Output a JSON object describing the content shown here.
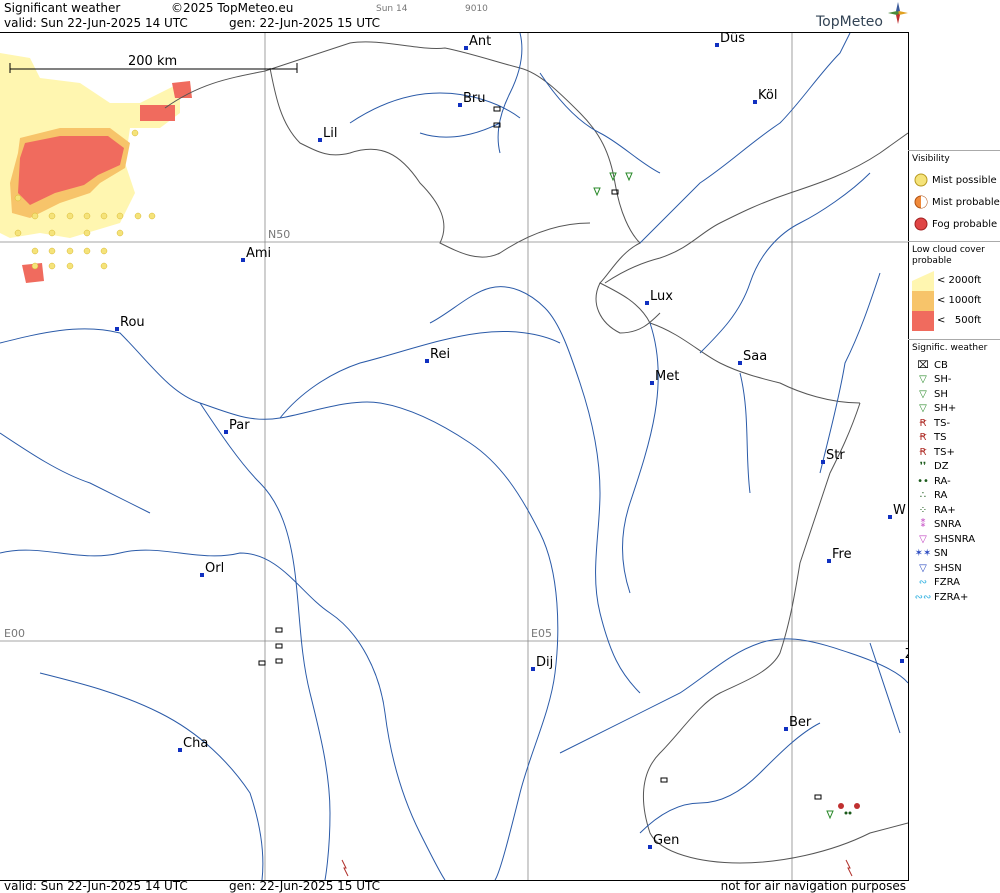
{
  "header": {
    "title": "Significant weather",
    "copyright": "©2025 TopMeteo.eu",
    "run_small": "Sun 14",
    "code_small": "9010",
    "valid": "valid:  Sun  22-Jun-2025  14 UTC",
    "gen": "gen: 22-Jun-2025 15 UTC",
    "logo": "TopMeteo"
  },
  "footer": {
    "valid": "valid:  Sun  22-Jun-2025  14 UTC",
    "gen": "gen: 22-Jun-2025 15 UTC",
    "disclaimer": "not for air navigation purposes"
  },
  "map": {
    "scale_label": "200 km",
    "grid_labels": {
      "lat": "N50",
      "lon_west": "E00",
      "lon_east": "E05"
    },
    "cities": [
      {
        "name": "Ant"
      },
      {
        "name": "Düs"
      },
      {
        "name": "Bru"
      },
      {
        "name": "Köl"
      },
      {
        "name": "Lil"
      },
      {
        "name": "Ami"
      },
      {
        "name": "Lux"
      },
      {
        "name": "Rou"
      },
      {
        "name": "Rei"
      },
      {
        "name": "Saa"
      },
      {
        "name": "Met"
      },
      {
        "name": "Par"
      },
      {
        "name": "Str"
      },
      {
        "name": "W"
      },
      {
        "name": "Fre"
      },
      {
        "name": "Orl"
      },
      {
        "name": "Dij"
      },
      {
        "name": "Ber"
      },
      {
        "name": "Cha"
      },
      {
        "name": "Gen"
      },
      {
        "name": "Z"
      }
    ]
  },
  "legend": {
    "visibility": {
      "title": "Visibility",
      "items": [
        {
          "label": "Mist possible",
          "color": "#f5e37a"
        },
        {
          "label": "Mist probable",
          "color": "#f08a3a"
        },
        {
          "label": "Fog probable",
          "color": "#e04545"
        }
      ]
    },
    "low_cloud": {
      "title": "Low cloud cover probable",
      "items": [
        {
          "label": "< 2000ft",
          "color": "#fff6b0"
        },
        {
          "label": "< 1000ft",
          "color": "#f7c46a"
        },
        {
          "label": "<   500ft",
          "color": "#f06b5e"
        }
      ]
    },
    "weather": {
      "title": "Signific. weather",
      "items": [
        {
          "label": "CB",
          "glyph": "⌧",
          "color": "#000"
        },
        {
          "label": "SH-",
          "glyph": "▽",
          "color": "#2a8a2a"
        },
        {
          "label": "SH",
          "glyph": "▽",
          "color": "#2a8a2a"
        },
        {
          "label": "SH+",
          "glyph": "▽",
          "color": "#2a8a2a"
        },
        {
          "label": "TS-",
          "glyph": "Ꞧ",
          "color": "#b0302a"
        },
        {
          "label": "TS",
          "glyph": "Ꞧ",
          "color": "#b0302a"
        },
        {
          "label": "TS+",
          "glyph": "Ꞧ",
          "color": "#b0302a"
        },
        {
          "label": "DZ",
          "glyph": "❜❜",
          "color": "#1a5a1a"
        },
        {
          "label": "RA-",
          "glyph": "••",
          "color": "#1a5a1a"
        },
        {
          "label": "RA",
          "glyph": "∴",
          "color": "#1a5a1a"
        },
        {
          "label": "RA+",
          "glyph": "⁘",
          "color": "#1a5a1a"
        },
        {
          "label": "SNRA",
          "glyph": "⁑",
          "color": "#c040c0"
        },
        {
          "label": "SHSNRA",
          "glyph": "▽",
          "color": "#c040c0"
        },
        {
          "label": "SN",
          "glyph": "✶✶",
          "color": "#2a4ac0"
        },
        {
          "label": "SHSN",
          "glyph": "▽",
          "color": "#2a4ac0"
        },
        {
          "label": "FZRA",
          "glyph": "∾",
          "color": "#30b0e0"
        },
        {
          "label": "FZRA+",
          "glyph": "∾∾",
          "color": "#30b0e0"
        }
      ]
    }
  }
}
